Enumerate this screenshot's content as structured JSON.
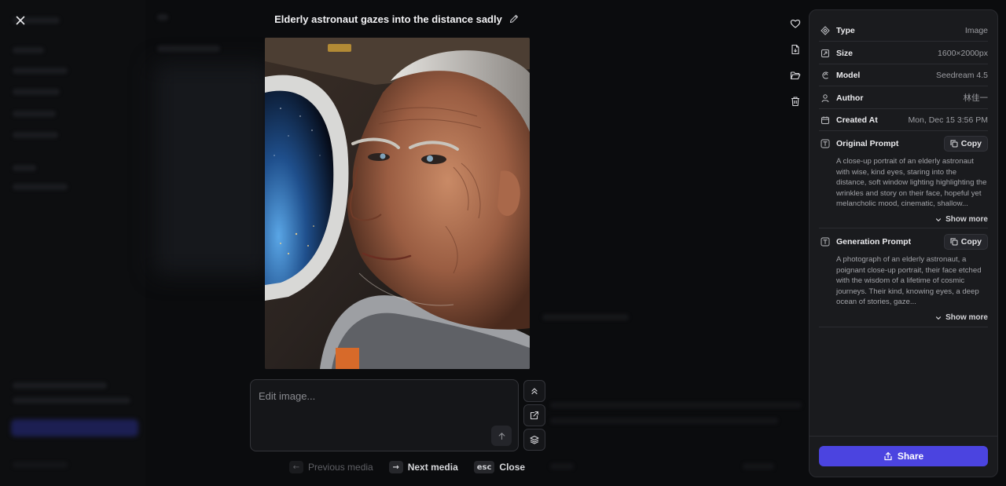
{
  "window": {
    "title": "Elderly astronaut gazes into the distance sadly"
  },
  "toolbar": {
    "close_icon": "close-icon",
    "edit_title_icon": "pencil-icon"
  },
  "side_actions": [
    {
      "name": "favorite",
      "icon": "heart-icon"
    },
    {
      "name": "download",
      "icon": "file-download-icon"
    },
    {
      "name": "move-to-folder",
      "icon": "folder-open-icon"
    },
    {
      "name": "delete",
      "icon": "trash-icon"
    }
  ],
  "editor": {
    "placeholder": "Edit image...",
    "value": ""
  },
  "tools": [
    "chevrons-up-icon",
    "edit-external-icon",
    "layers-icon"
  ],
  "hints": {
    "prev_key": "←",
    "prev_label": "Previous media",
    "next_key": "→",
    "next_label": "Next media",
    "close_key": "esc",
    "close_label": "Close"
  },
  "details": {
    "type_label": "Type",
    "type_value": "Image",
    "size_label": "Size",
    "size_value": "1600×2000px",
    "model_label": "Model",
    "model_value": "Seedream 4.5",
    "author_label": "Author",
    "author_value": "林佳一",
    "created_label": "Created At",
    "created_value": "Mon, Dec 15 3:56 PM"
  },
  "original_prompt": {
    "label": "Original Prompt",
    "copy": "Copy",
    "text": "A close-up portrait of an elderly astronaut with wise, kind eyes, staring into the distance, soft window lighting highlighting the wrinkles and story on their face, hopeful yet melancholic mood, cinematic, shallow...",
    "show_more": "Show more"
  },
  "generation_prompt": {
    "label": "Generation Prompt",
    "copy": "Copy",
    "text": "A photograph of an elderly astronaut, a poignant close-up portrait, their face etched with the wisdom of a lifetime of cosmic journeys. Their kind, knowing eyes, a deep ocean of stories, gaze...",
    "show_more": "Show more"
  },
  "share": {
    "label": "Share"
  },
  "colors": {
    "accent": "#4b44e0",
    "panel": "#1a1b1e",
    "background": "#0b0c0e"
  }
}
